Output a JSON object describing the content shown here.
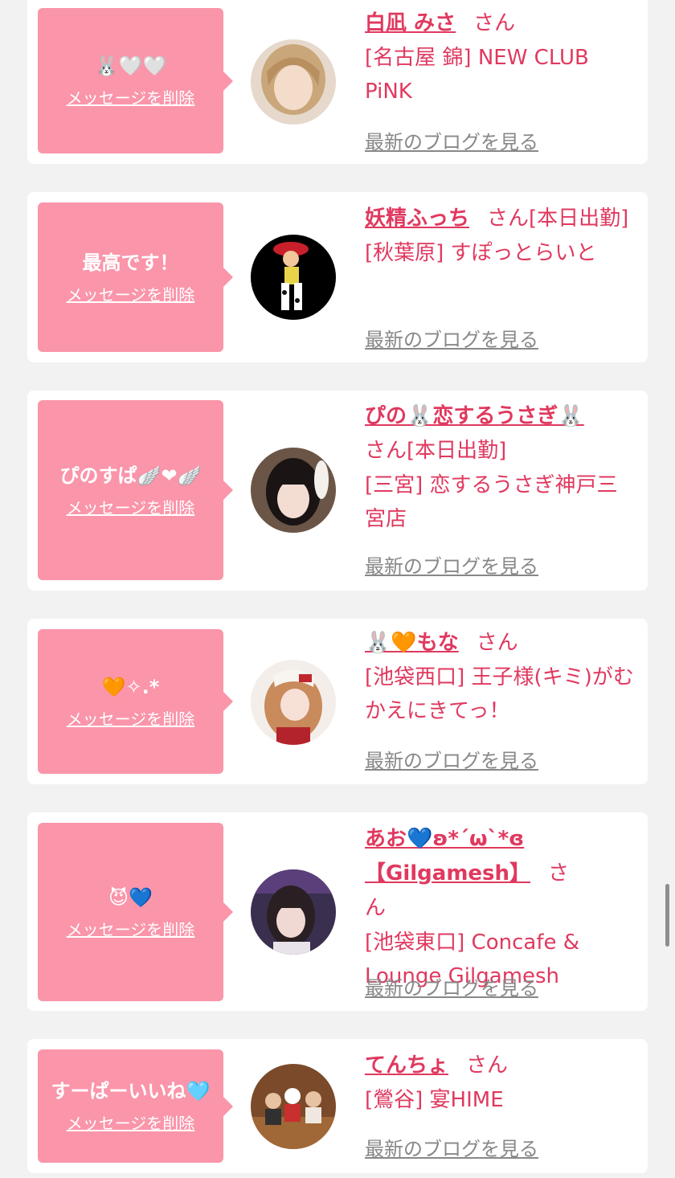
{
  "delete_label": "メッセージを削除",
  "blog_label": "最新のブログを見る",
  "honorific": "さん",
  "cards": [
    {
      "message": "🐰🤍🤍",
      "name": "白凪 みさ",
      "status": "",
      "shop": "[名古屋 錦] NEW CLUB PiNK"
    },
    {
      "message": "最高です！",
      "name": "妖精ふっち",
      "status": "[本日出勤]",
      "shop": "[秋葉原] すぽっとらいと"
    },
    {
      "message": "ぴのすぱ🪽❤🪽",
      "name": "ぴの🐰恋するうさぎ🐰",
      "status": "[本日出勤]",
      "shop": "[三宮] 恋するうさぎ神戸三宮店"
    },
    {
      "message": "🧡✧.*",
      "name": "🐰🧡もな",
      "status": "",
      "shop": "[池袋西口] 王子様(キミ)がむかえにきてっ！"
    },
    {
      "message": "😈💙",
      "name": "あお💙ʚ*ˊωˋ*ɞ 【Gilgamesh】",
      "status": "",
      "shop": "[池袋東口] Concafe & Lounge Gilgamesh"
    },
    {
      "message": "すーぱーいいね🩵",
      "name": "てんちょ",
      "status": "",
      "shop": "[鶯谷] 宴HIME"
    }
  ],
  "colors": {
    "accent": "#e0395f",
    "bubble": "#fa95aa",
    "link_gray": "#888888",
    "page_bg": "#f2f2f2"
  }
}
